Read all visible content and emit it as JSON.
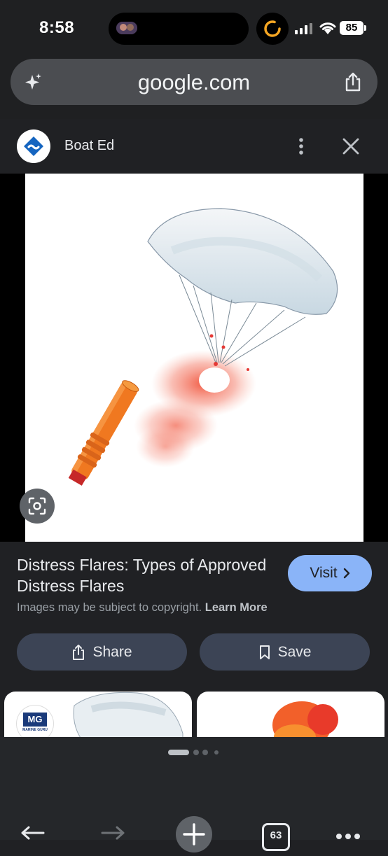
{
  "status_bar": {
    "time": "8:58",
    "battery": "85"
  },
  "browser": {
    "url": "google.com"
  },
  "source": {
    "name": "Boat Ed",
    "logo_icon": "boat-ed-logo-icon"
  },
  "result": {
    "title": "Distress Flares: Types of Approved Distress Flares",
    "visit_label": "Visit",
    "copyright_prefix": "Images may be subject to copyright.",
    "learn_more": "Learn More",
    "share_label": "Share",
    "save_label": "Save"
  },
  "related": {
    "logo_text": "MG",
    "logo_subtext": "MARINE GURU"
  },
  "toolbar": {
    "tab_count": "63"
  },
  "colors": {
    "accent": "#8ab4f8",
    "background": "#202124",
    "button": "#3c4455",
    "flare": "#f07820"
  }
}
